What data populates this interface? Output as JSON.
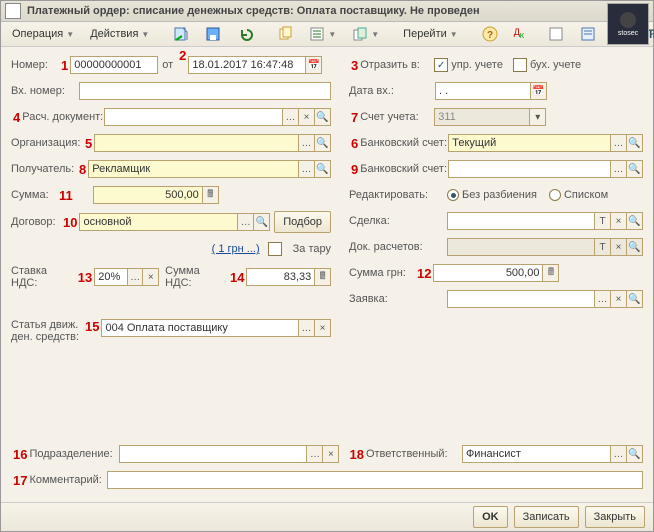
{
  "window": {
    "title": "Платежный ордер: списание денежных средств: Оплата поставщику. Не проведен"
  },
  "toolbar": {
    "operation": "Операция",
    "actions": "Действия",
    "goto": "Перейти"
  },
  "annotations": {
    "n1": "1",
    "n2": "2",
    "n3": "3",
    "n4": "4",
    "n5": "5",
    "n6": "6",
    "n7": "7",
    "n8": "8",
    "n9": "9",
    "n10": "10",
    "n11": "11",
    "n12": "12",
    "n13": "13",
    "n14": "14",
    "n15": "15",
    "n16": "16",
    "n17": "17",
    "n18": "18"
  },
  "labels": {
    "number": "Номер:",
    "ot": "от",
    "vhnumber": "Вх. номер:",
    "raschdoc": "Расч. документ:",
    "org": "Организация:",
    "recipient": "Получатель:",
    "sum": "Сумма:",
    "contract": "Договор:",
    "vatRate": "Ставка НДС:",
    "vatSum": "Сумма НДС:",
    "cashflow": "Статья движ.\nден. средств:",
    "reflect": "Отразить в:",
    "mgmt": "упр. учете",
    "acct": "бух. учете",
    "datevh": "Дата вх.:",
    "account": "Счет учета:",
    "bank1": "Банковский счет:",
    "bank2": "Банковский счет:",
    "edit": "Редактировать:",
    "nosplit": "Без разбиения",
    "list": "Списком",
    "deal": "Сделка:",
    "docras": "Док. расчетов:",
    "sumgrn": "Сумма грн:",
    "request": "Заявка:",
    "subdiv": "Подразделение:",
    "responsible": "Ответственный:",
    "comment": "Комментарий:",
    "hint": "( 1 грн ...)",
    "zatara": "За тару",
    "podbor": "Подбор"
  },
  "values": {
    "number": "00000000001",
    "date": "18.01.2017 16:47:48",
    "datevh": ". .",
    "account": "311",
    "bank1": "Текущий",
    "recipient": "Рекламщик",
    "sum": "500,00",
    "contract": "основной",
    "vatRate": "20%",
    "vatSum": "83,33",
    "sumgrn": "500,00",
    "cashflow": "004 Оплата поставщику",
    "responsible": "Финансист"
  },
  "footer": {
    "ok": "OK",
    "save": "Записать",
    "close": "Закрыть"
  }
}
